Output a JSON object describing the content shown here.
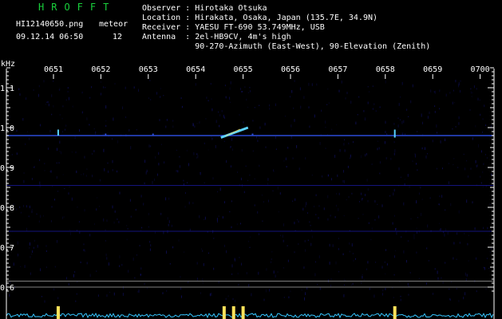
{
  "header": {
    "brand": "HROFFT",
    "filename": "HI12140650.png",
    "datetime": "09.12.14 06:50",
    "meteor_label": "meteor",
    "meteor_count": "12",
    "info_lines": [
      "Observer : Hirotaka Otsuka",
      "Location : Hirakata, Osaka, Japan (135.7E, 34.9N)",
      "Receiver : YAESU FT-690 53.749MHz, USB",
      "Antenna  : 2el-HB9CV, 4m's high",
      "           90-270-Azimuth (East-West), 90-Elevation (Zenith)"
    ]
  },
  "colors": {
    "background": "#000000",
    "brand": "#19d13c",
    "text": "#ffffff",
    "axis": "#ffffff",
    "grid": "#7f7f7f",
    "noise": "#1a1a9c",
    "carrier": "#2b4bd6",
    "echo": "#5ad2ff",
    "echo_hot": "#ffe35a",
    "bottom_trace": "#36c6ff"
  },
  "chart_data": {
    "type": "heatmap",
    "ylabel": "kHz",
    "x_tick_labels": [
      "0651",
      "0652",
      "0653",
      "0654",
      "0655",
      "0656",
      "0657",
      "0658",
      "0659",
      "0700"
    ],
    "x_range_minutes": [
      0,
      10
    ],
    "y_tick_labels": [
      "1.1",
      "1.0",
      "0.9",
      "0.8",
      "0.7",
      "0.6"
    ],
    "y_range_khz": [
      0.58,
      1.16
    ],
    "carrier_khz": 0.98,
    "faint_lines_khz": [
      0.855,
      0.74
    ],
    "reference_lines_khz": [
      0.615,
      0.6
    ],
    "echoes": [
      {
        "minute": 0.1,
        "khz_from": 0.98,
        "khz_to": 0.995,
        "strength": "medium"
      },
      {
        "minute": 1.1,
        "khz_from": 0.98,
        "khz_to": 0.985,
        "strength": "weak"
      },
      {
        "minute": 2.1,
        "khz_from": 0.98,
        "khz_to": 0.985,
        "strength": "weak"
      },
      {
        "minute": 3.7,
        "khz_from": 0.975,
        "khz_to": 1.0,
        "strength": "strong"
      },
      {
        "minute": 4.2,
        "khz_from": 0.98,
        "khz_to": 0.985,
        "strength": "weak"
      },
      {
        "minute": 7.2,
        "khz_from": 0.975,
        "khz_to": 0.995,
        "strength": "medium"
      }
    ],
    "bottom_spikes_minutes": [
      0.1,
      3.6,
      3.8,
      4.0,
      7.2
    ]
  }
}
